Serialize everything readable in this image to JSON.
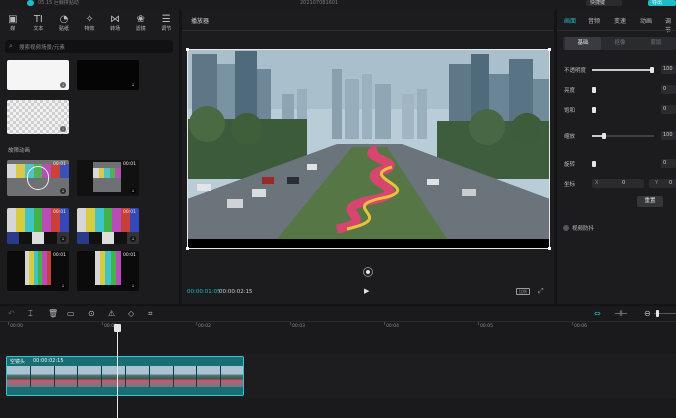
{
  "window": {
    "project_text": "05.15 巨鲸拼贴动",
    "title": "202107081601",
    "shortcut_label": "快捷键",
    "export_label": "导出"
  },
  "left_panel": {
    "toolbar": [
      {
        "icon": "media-icon",
        "glyph": "▣",
        "label": "媒"
      },
      {
        "icon": "text-icon",
        "glyph": "TI",
        "label": "文本"
      },
      {
        "icon": "sticker-icon",
        "glyph": "◔",
        "label": "贴纸"
      },
      {
        "icon": "effects-icon",
        "glyph": "✧",
        "label": "特效"
      },
      {
        "icon": "transition-icon",
        "glyph": "⋈",
        "label": "转场"
      },
      {
        "icon": "filter-icon",
        "glyph": "❀",
        "label": "滤镜"
      },
      {
        "icon": "adjust-icon",
        "glyph": "☰",
        "label": "调节"
      }
    ],
    "search_placeholder": "搜索视频场景/元素",
    "section_title": "故障动画",
    "thumbs": [
      {
        "kind": "white",
        "duration": ""
      },
      {
        "kind": "black",
        "duration": ""
      },
      {
        "kind": "check",
        "duration": ""
      },
      {
        "kind": "testcard",
        "duration": "00:01"
      },
      {
        "kind": "testcard2",
        "duration": "00:01"
      },
      {
        "kind": "bars",
        "duration": "00:01"
      },
      {
        "kind": "bars",
        "duration": "00:01"
      },
      {
        "kind": "bars-narrow",
        "duration": "00:01"
      },
      {
        "kind": "bars-narrow2",
        "duration": "00:01"
      }
    ]
  },
  "player": {
    "header": "播放器",
    "current_time": "00:00:01:05",
    "total_time": "00:00:02:15",
    "aspect_label": "比例"
  },
  "right_panel": {
    "tabs": [
      {
        "label": "画面",
        "active": true
      },
      {
        "label": "音频",
        "active": false
      },
      {
        "label": "变速",
        "active": false
      },
      {
        "label": "动画",
        "active": false
      },
      {
        "label": "调节",
        "active": false
      }
    ],
    "subtabs": [
      {
        "label": "基础",
        "active": true
      },
      {
        "label": "抠像",
        "active": false
      },
      {
        "label": "蒙版",
        "active": false
      }
    ],
    "properties": [
      {
        "label": "不透明度",
        "value": "100",
        "level": 1.0
      },
      {
        "label": "亮度",
        "value": "0",
        "level": 0.0
      },
      {
        "label": "饱和",
        "value": "0",
        "level": 0.0
      },
      {
        "label": "缩放",
        "value": "100",
        "level": 0.18
      },
      {
        "label": "旋转",
        "value": "0",
        "level": 0.0
      }
    ],
    "position_label": "坐标",
    "pos_x_label": "X",
    "pos_x_value": "0",
    "pos_y_label": "Y",
    "pos_y_value": "0",
    "reset_label": "重置",
    "stabilize_label": "视频防抖"
  },
  "timeline": {
    "ruler_labels": [
      "00:00",
      "00:01",
      "00:02",
      "00:03",
      "00:04",
      "00:05",
      "00:06"
    ],
    "clip_name": "空镜头",
    "clip_duration": "00:00:02:15",
    "playhead_time": "00:00:01:05"
  },
  "colors": {
    "accent": "#1fbcc6",
    "panel": "#1c1c1f",
    "clip": "#1a6d73"
  }
}
